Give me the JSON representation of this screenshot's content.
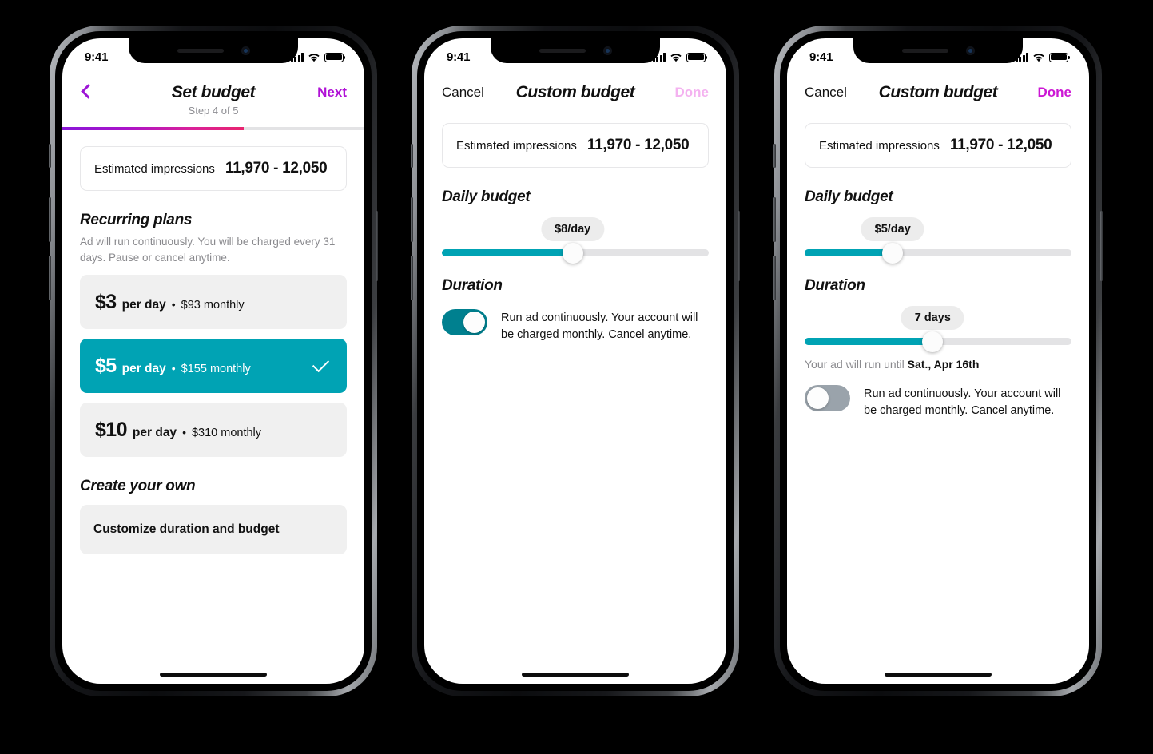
{
  "colors": {
    "teal": "#00a3b4",
    "teal_toggle": "#00808f",
    "purple": "#b012d6",
    "magenta": "#cc17d4",
    "pink_disabled": "#f4b2f0",
    "gray_card": "#f0f0f0",
    "track_gray": "#e3e3e5"
  },
  "status_bar": {
    "time": "9:41",
    "signal_icon": "cellular-bars-icon",
    "wifi_icon": "wifi-icon",
    "battery_icon": "battery-full-icon"
  },
  "screen1": {
    "nav": {
      "back_icon": "chevron-left-icon",
      "title": "Set budget",
      "action": "Next"
    },
    "step_label": "Step 4 of 5",
    "progress_percent": 60,
    "estimated": {
      "label": "Estimated impressions",
      "value": "11,970 - 12,050"
    },
    "recurring": {
      "title": "Recurring plans",
      "description": "Ad will run continuously. You will be charged every 31 days. Pause or cancel anytime."
    },
    "plans": [
      {
        "amount": "$3",
        "per": "per day",
        "dot": "•",
        "monthly": "$93 monthly",
        "selected": false
      },
      {
        "amount": "$5",
        "per": "per day",
        "dot": "•",
        "monthly": "$155 monthly",
        "selected": true
      },
      {
        "amount": "$10",
        "per": "per day",
        "dot": "•",
        "monthly": "$310 monthly",
        "selected": false
      }
    ],
    "create": {
      "title": "Create your own",
      "card_label": "Customize duration and budget"
    }
  },
  "screen2": {
    "nav": {
      "cancel": "Cancel",
      "title": "Custom budget",
      "action": "Done"
    },
    "estimated": {
      "label": "Estimated impressions",
      "value": "11,970 - 12,050"
    },
    "daily_budget": {
      "title": "Daily budget",
      "bubble": "$8/day",
      "fill_percent": 49
    },
    "duration": {
      "title": "Duration"
    },
    "toggle": {
      "state": "on",
      "text": "Run ad continuously. Your account will be charged monthly. Cancel anytime."
    }
  },
  "screen3": {
    "nav": {
      "cancel": "Cancel",
      "title": "Custom budget",
      "action": "Done"
    },
    "estimated": {
      "label": "Estimated impressions",
      "value": "11,970 - 12,050"
    },
    "daily_budget": {
      "title": "Daily budget",
      "bubble": "$5/day",
      "fill_percent": 33
    },
    "duration": {
      "title": "Duration",
      "bubble": "7 days",
      "fill_percent": 48,
      "until_prefix": "Your ad will run until ",
      "until_date": "Sat., Apr 16th"
    },
    "toggle": {
      "state": "off",
      "text": "Run ad continuously. Your account will be charged monthly. Cancel anytime."
    }
  }
}
